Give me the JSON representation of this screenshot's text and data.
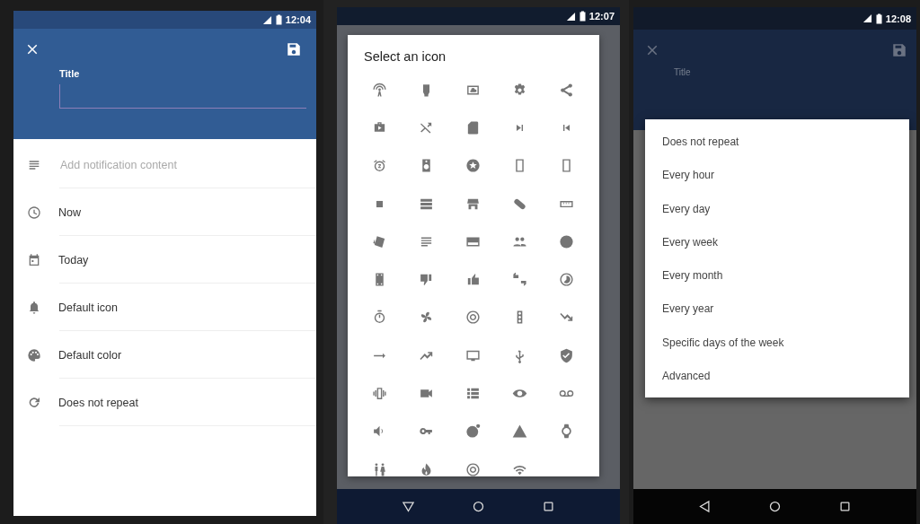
{
  "screens": [
    {
      "kind": "editor",
      "status_bar": {
        "time": "12:04"
      },
      "title_field": {
        "label": "Title"
      },
      "rows": [
        {
          "kind": "content",
          "placeholder": "Add notification content"
        },
        {
          "kind": "time",
          "text": "Now"
        },
        {
          "kind": "date",
          "text": "Today"
        },
        {
          "kind": "icon",
          "text": "Default icon"
        },
        {
          "kind": "color",
          "text": "Default color"
        },
        {
          "kind": "repeat",
          "text": "Does not repeat"
        }
      ]
    },
    {
      "kind": "icon_picker",
      "status_bar": {
        "time": "12:07"
      },
      "dialog": {
        "title": "Select an icon"
      }
    },
    {
      "kind": "repeat_menu",
      "status_bar": {
        "time": "12:08"
      },
      "background": {
        "title_label": "Title"
      },
      "menu": {
        "items": [
          "Does not repeat",
          "Every hour",
          "Every day",
          "Every week",
          "Every month",
          "Every year",
          "Specific days of the week",
          "Advanced"
        ]
      }
    }
  ]
}
